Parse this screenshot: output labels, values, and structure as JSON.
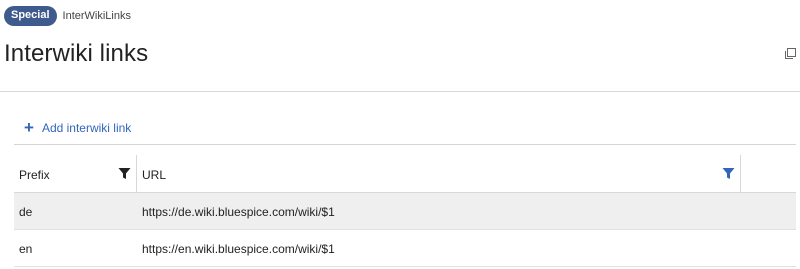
{
  "breadcrumb": {
    "badge": "Special",
    "page": "InterWikiLinks"
  },
  "title": "Interwiki links",
  "toolbar": {
    "add_label": "Add interwiki link"
  },
  "grid": {
    "columns": [
      "Prefix",
      "URL"
    ],
    "rows": [
      {
        "prefix": "de",
        "url": "https://de.wiki.bluespice.com/wiki/$1"
      },
      {
        "prefix": "en",
        "url": "https://en.wiki.bluespice.com/wiki/$1"
      }
    ]
  },
  "colors": {
    "badge": "#3f5a8c",
    "accent": "#3366bb",
    "row_alt": "#efefef"
  }
}
